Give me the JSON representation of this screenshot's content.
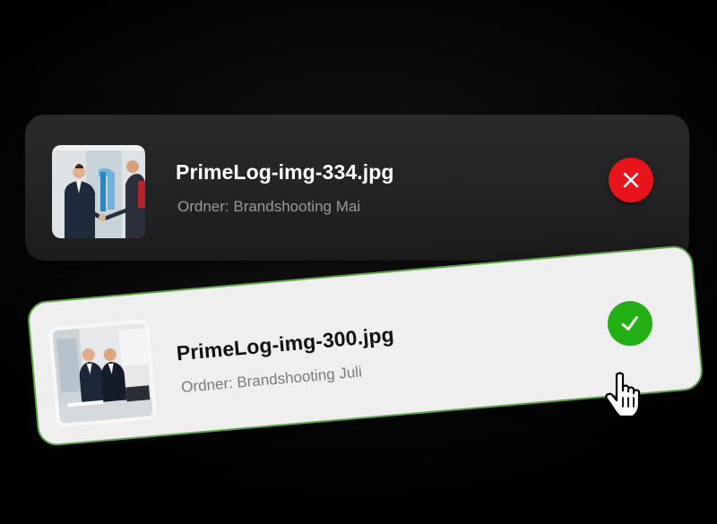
{
  "files": [
    {
      "name": "PrimeLog-img-334.jpg",
      "folder": "Ordner: Brandshooting Mai",
      "status": "rejected",
      "status_icon": "close-icon",
      "status_color": "#e8141c"
    },
    {
      "name": "PrimeLog-img-300.jpg",
      "folder": "Ordner: Brandshooting Juli",
      "status": "approved",
      "status_icon": "checkmark-icon",
      "status_color": "#22b014"
    }
  ],
  "colors": {
    "background": "#000000",
    "dark_card": "#222222",
    "light_card": "#efefef",
    "selected_border": "#5fa64a"
  },
  "cursor_icon": "hand-pointer-icon"
}
